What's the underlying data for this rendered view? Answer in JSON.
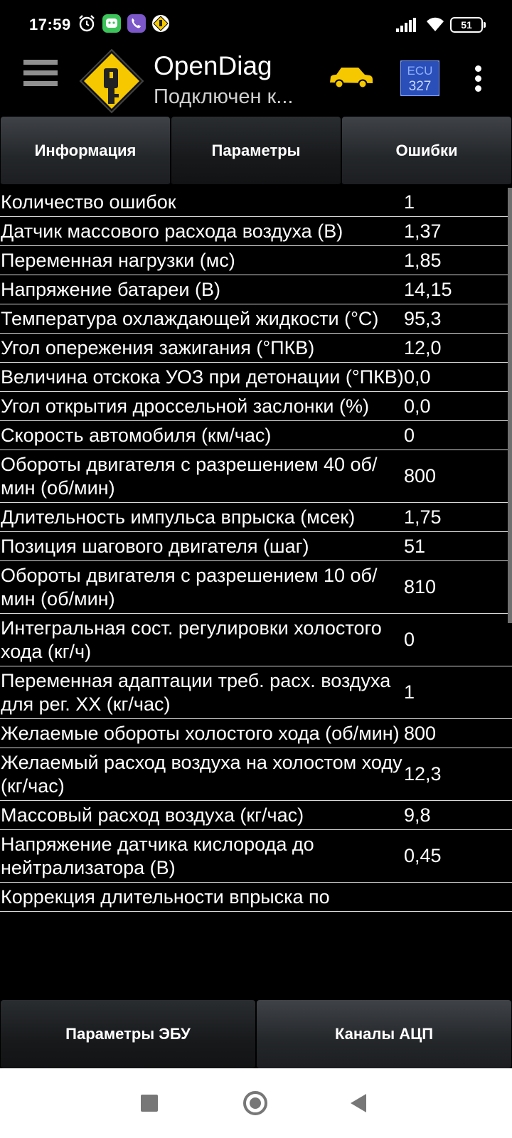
{
  "status_bar": {
    "time": "17:59",
    "battery": "51",
    "icons": [
      "alarm-icon",
      "messenger-icon",
      "viber-icon",
      "opendiag-notification-icon",
      "signal-icon",
      "wifi-icon",
      "battery-icon"
    ]
  },
  "app_bar": {
    "title": "OpenDiag",
    "subtitle": "Подключен к...",
    "icons": [
      "menu-icon",
      "opendiag-logo-icon",
      "car-icon",
      "ecu-icon",
      "more-vert-icon"
    ],
    "accent_color": "#f5c800"
  },
  "tabs": [
    {
      "label": "Информация"
    },
    {
      "label": "Параметры"
    },
    {
      "label": "Ошибки"
    }
  ],
  "params": [
    {
      "name": "Количество ошибок",
      "value": "1"
    },
    {
      "name": "Датчик массового расхода воздуха (В)",
      "value": "1,37"
    },
    {
      "name": "Переменная нагрузки (мс)",
      "value": "1,85"
    },
    {
      "name": "Напряжение батареи (В)",
      "value": "14,15"
    },
    {
      "name": "Температура охлаждающей жидкости (°С)",
      "value": "95,3"
    },
    {
      "name": "Угол опережения зажигания (°ПКВ)",
      "value": "12,0"
    },
    {
      "name": "Величина отскока УОЗ при детонации (°ПКВ)",
      "value": "0,0"
    },
    {
      "name": "Угол открытия дроссельной заслонки (%)",
      "value": "0,0"
    },
    {
      "name": "Скорость автомобиля (км/час)",
      "value": "0"
    },
    {
      "name": "Обороты двигателя с разрешением 40 об/мин (об/мин)",
      "value": "800"
    },
    {
      "name": "Длительность импульса впрыска (мсек)",
      "value": "1,75"
    },
    {
      "name": "Позиция шагового двигателя (шаг)",
      "value": "51"
    },
    {
      "name": "Обороты двигателя с разрешением 10 об/мин (об/мин)",
      "value": "810"
    },
    {
      "name": "Интегральная сост. регулировки холостого хода (кг/ч)",
      "value": "0"
    },
    {
      "name": "Переменная адаптации треб. расх. воздуха для рег. ХХ (кг/час)",
      "value": "1"
    },
    {
      "name": "Желаемые обороты холостого хода (об/мин)",
      "value": "800"
    },
    {
      "name": "Желаемый расход воздуха на холостом ходу (кг/час)",
      "value": "12,3"
    },
    {
      "name": "Массовый расход воздуха (кг/час)",
      "value": "9,8"
    },
    {
      "name": "Напряжение датчика кислорода до нейтрализатора (В)",
      "value": "0,45"
    },
    {
      "name": "Коррекция длительности впрыска по",
      "value": ""
    }
  ],
  "bottom_tabs": [
    {
      "label": "Параметры ЭБУ"
    },
    {
      "label": "Каналы АЦП"
    }
  ],
  "ecu_icon_text": {
    "top": "ECU",
    "bottom": "327"
  }
}
